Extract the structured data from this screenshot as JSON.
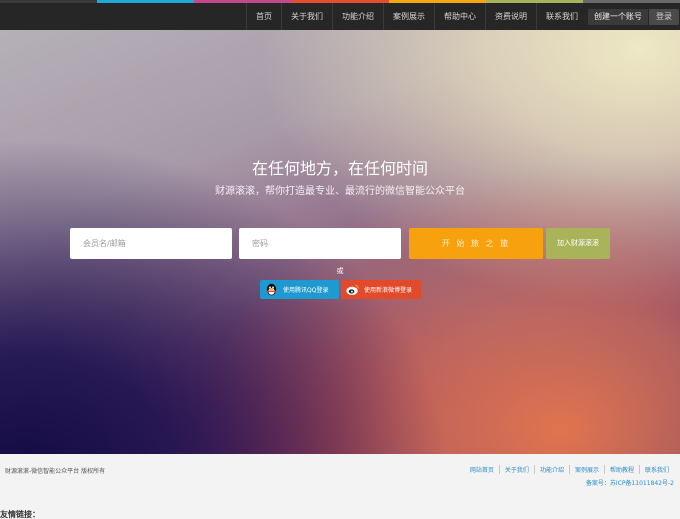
{
  "top_strip_colors": [
    "#3a3a3a",
    "#1fa8d8",
    "#c24a8a",
    "#e44d2e",
    "#f5a70f",
    "#a9b45a",
    "#6a6a6a"
  ],
  "nav": {
    "items": [
      {
        "label": "首页"
      },
      {
        "label": "关于我们"
      },
      {
        "label": "功能介绍"
      },
      {
        "label": "案例展示"
      },
      {
        "label": "帮助中心"
      },
      {
        "label": "资费说明"
      },
      {
        "label": "联系我们"
      }
    ],
    "register_label": "创建一个账号",
    "login_label": "登录"
  },
  "hero": {
    "title": "在任何地方，在任何时间",
    "subtitle": "财源滚滚，帮你打造最专业、最流行的微信智能公众平台"
  },
  "login_form": {
    "username_placeholder": "会员名/邮箱",
    "password_placeholder": "密码",
    "start_label": "开 始 旅 之 旅",
    "join_label": "加入财源滚滚",
    "or_label": "或",
    "qq_label": "使用腾讯QQ登录",
    "weibo_label": "使用新浪微博登录"
  },
  "colors": {
    "accent_orange": "#f8a10e",
    "accent_olive": "#a9b45a",
    "qq_blue": "#1e9ad0",
    "weibo_red": "#e24a2c",
    "link_blue": "#2d8cc8"
  },
  "footer": {
    "copyright": "财源滚滚-微信智能公众平台 版权所有",
    "links": [
      {
        "label": "网站首页"
      },
      {
        "label": "关于我们"
      },
      {
        "label": "功能介绍"
      },
      {
        "label": "案例展示"
      },
      {
        "label": "帮助教程"
      },
      {
        "label": "联系我们"
      }
    ],
    "icp": "备案号：苏ICP备11011842号-2",
    "friend_links_label": "友情链接："
  }
}
